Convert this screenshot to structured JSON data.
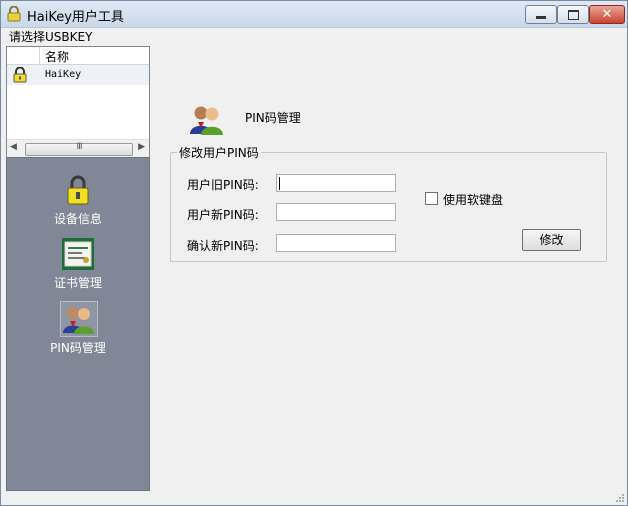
{
  "window": {
    "title": "HaiKey用户工具",
    "minimize_icon": "minimize-icon",
    "maximize_icon": "maximize-icon",
    "close_icon": "close-icon"
  },
  "device_list": {
    "label": "请选择USBKEY",
    "column_header": "名称",
    "items": [
      {
        "name": "HaiKey",
        "icon": "lock-icon"
      }
    ],
    "scroll_thumb_glyph": "III"
  },
  "nav": {
    "items": [
      {
        "label": "设备信息",
        "icon": "lock-icon"
      },
      {
        "label": "证书管理",
        "icon": "certificate-icon"
      },
      {
        "label": "PIN码管理",
        "icon": "users-icon",
        "selected": true
      }
    ]
  },
  "pin_panel": {
    "title": "PIN码管理",
    "group_title": "修改用户PIN码",
    "old_pin_label": "用户旧PIN码:",
    "new_pin_label": "用户新PIN码:",
    "confirm_pin_label": "确认新PIN码:",
    "old_pin_value": "",
    "new_pin_value": "",
    "confirm_pin_value": "",
    "soft_keyboard_label": "使用软键盘",
    "soft_keyboard_checked": false,
    "submit_label": "修改"
  }
}
